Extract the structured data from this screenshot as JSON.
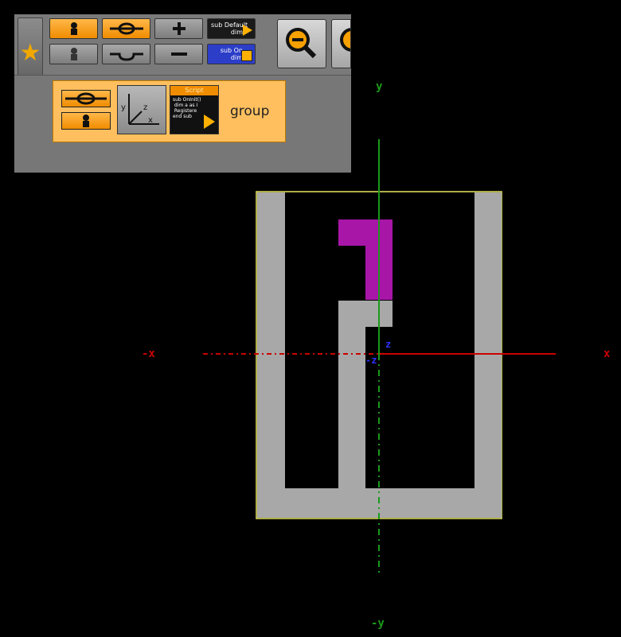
{
  "toolbar": {
    "row1": [
      {
        "icon": "person-icon"
      },
      {
        "icon": "key-icon"
      },
      {
        "icon": "plus-icon"
      },
      {
        "text": "sub Default\ndim",
        "icon": "play-icon"
      }
    ],
    "row2": [
      {
        "icon": "person-gray-icon"
      },
      {
        "icon": "curve-icon"
      },
      {
        "icon": "minus-icon"
      },
      {
        "text": "sub On\ndim",
        "icon": "stop-icon"
      }
    ],
    "zoom_icon": "zoom-out-icon"
  },
  "node_bar": {
    "script_title": "Script",
    "script_code": "sub OnInit()\n dim a as I\n Registere\nend sub",
    "group_label": "group"
  },
  "viewport": {
    "axis_labels": {
      "x_pos": "x",
      "x_neg": "-x",
      "y_pos": "y",
      "y_neg": "-y",
      "z_pos": "z",
      "z_neg": "-z"
    },
    "colors": {
      "x_axis": "#cc0000",
      "y_axis": "#1a9a1a",
      "z_axis": "#3030ff",
      "frame": "#e8e860",
      "shape": "#a8a8a8",
      "highlight": "#a816a8"
    }
  }
}
